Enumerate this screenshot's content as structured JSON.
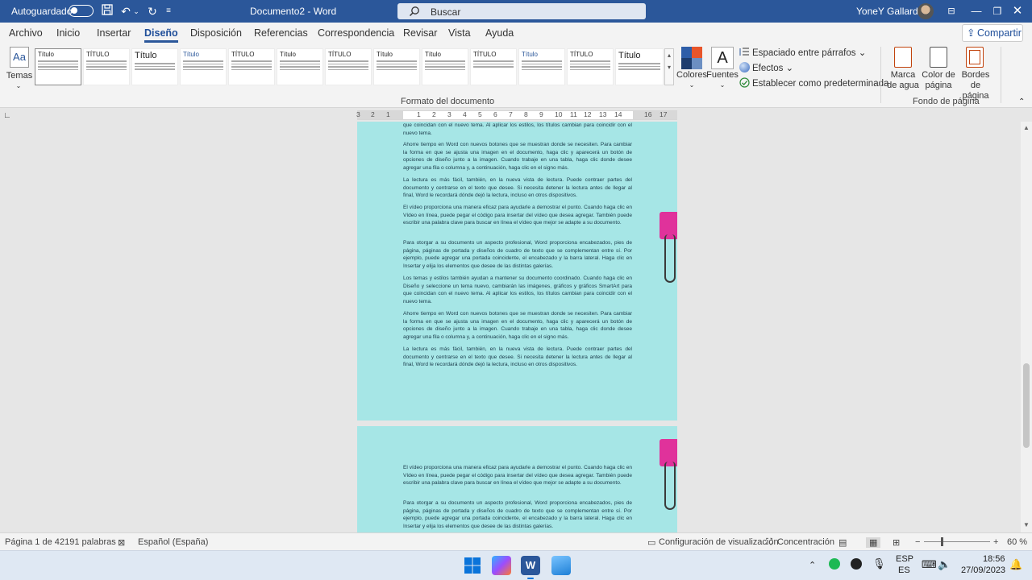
{
  "titlebar": {
    "autosave_label": "Autoguardado",
    "document_title": "Documento2  -  Word",
    "search_placeholder": "Buscar",
    "user_name": "YoneY Gallardo"
  },
  "tabs": [
    {
      "label": "Archivo"
    },
    {
      "label": "Inicio"
    },
    {
      "label": "Insertar"
    },
    {
      "label": "Diseño"
    },
    {
      "label": "Disposición"
    },
    {
      "label": "Referencias"
    },
    {
      "label": "Correspondencia"
    },
    {
      "label": "Revisar"
    },
    {
      "label": "Vista"
    },
    {
      "label": "Ayuda"
    }
  ],
  "share_label": "Compartir",
  "ribbon": {
    "temas_label": "Temas",
    "style_gallery": [
      {
        "title": "Título"
      },
      {
        "title": "TÍTULO"
      },
      {
        "title": "Título"
      },
      {
        "title": "Título"
      },
      {
        "title": "TÍTULO"
      },
      {
        "title": "Título"
      },
      {
        "title": "TÍTULO"
      },
      {
        "title": "Título"
      },
      {
        "title": "Título"
      },
      {
        "title": "TÍTULO"
      },
      {
        "title": "Título"
      },
      {
        "title": "TÍTULO"
      },
      {
        "title": "Título"
      },
      {
        "title": "Título"
      }
    ],
    "colores_label": "Colores",
    "fuentes_label": "Fuentes",
    "espaciado_label": "Espaciado entre párrafos",
    "efectos_label": "Efectos",
    "predeterminada_label": "Establecer como predeterminada",
    "marca_agua_label": "Marca de agua",
    "color_pagina_label": "Color de página",
    "bordes_label": "Bordes de página",
    "group_formato": "Formato del documento",
    "group_fondo": "Fondo de página"
  },
  "ruler_ticks": [
    "3",
    "2",
    "1",
    "1",
    "2",
    "3",
    "4",
    "5",
    "6",
    "7",
    "8",
    "9",
    "10",
    "11",
    "12",
    "13",
    "14",
    "16",
    "17"
  ],
  "page1": {
    "paragraphs": [
      "que coincidan con el nuevo tema. Al aplicar los estilos, los títulos cambian para coincidir con el nuevo tema.",
      "Ahorre tiempo en Word con nuevos botones que se muestran donde se necesiten. Para cambiar la forma en que se ajusta una imagen en el documento, haga clic y aparecerá un botón de opciones de diseño junto a la imagen. Cuando trabaje en una tabla, haga clic donde desee agregar una fila o columna y, a continuación, haga clic en el signo más.",
      "La lectura es más fácil, también, en la nueva vista de lectura. Puede contraer partes del documento y centrarse en el texto que desee. Si necesita detener la lectura antes de llegar al final, Word le recordará dónde dejó la lectura, incluso en otros dispositivos.",
      "El vídeo proporciona una manera eficaz para ayudarle a demostrar el punto. Cuando haga clic en Vídeo en línea, puede pegar el código para insertar del vídeo que desea agregar. También puede escribir una palabra clave para buscar en línea el vídeo que mejor se adapte a su documento.",
      "Para otorgar a su documento un aspecto profesional, Word proporciona encabezados, pies de página, páginas de portada y diseños de cuadro de texto que se complementan entre sí. Por ejemplo, puede agregar una portada coincidente, el encabezado y la barra lateral. Haga clic en Insertar y elija los elementos que desee de las distintas galerías.",
      "Los temas y estilos también ayudan a mantener su documento coordinado. Cuando haga clic en Diseño y seleccione un tema nuevo, cambiarán las imágenes, gráficos y gráficos SmartArt para que coincidan con el nuevo tema. Al aplicar los estilos, los títulos cambian para coincidir con el nuevo tema.",
      "Ahorre tiempo en Word con nuevos botones que se muestran donde se necesiten. Para cambiar la forma en que se ajusta una imagen en el documento, haga clic y aparecerá un botón de opciones de diseño junto a la imagen. Cuando trabaje en una tabla, haga clic donde desee agregar una fila o columna y, a continuación, haga clic en el signo más.",
      "La lectura es más fácil, también, en la nueva vista de lectura. Puede contraer partes del documento y centrarse en el texto que desee. Si necesita detener la lectura antes de llegar al final, Word le recordará dónde dejó la lectura, incluso en otros dispositivos."
    ]
  },
  "page2": {
    "paragraphs": [
      "El vídeo proporciona una manera eficaz para ayudarle a demostrar el punto. Cuando haga clic en Vídeo en línea, puede pegar el código para insertar del vídeo que desea agregar. También puede escribir una palabra clave para buscar en línea el vídeo que mejor se adapte a su documento.",
      "Para otorgar a su documento un aspecto profesional, Word proporciona encabezados, pies de página, páginas de portada y diseños de cuadro de texto que se complementan entre sí. Por ejemplo, puede agregar una portada coincidente, el encabezado y la barra lateral. Haga clic en Insertar y elija los elementos que desee de las distintas galerías."
    ]
  },
  "statusbar": {
    "page_info": "Página 1 de 4",
    "word_count": "2191 palabras",
    "language": "Español (España)",
    "display_settings": "Configuración de visualización",
    "focus": "Concentración",
    "zoom": "60 %"
  },
  "taskbar": {
    "lang_line1": "ESP",
    "lang_line2": "ES",
    "time": "18:56",
    "date": "27/09/2023"
  },
  "colors": {
    "titlebar": "#2b579a",
    "page_background": "#a6e6e6",
    "clip": "#e0329b"
  }
}
